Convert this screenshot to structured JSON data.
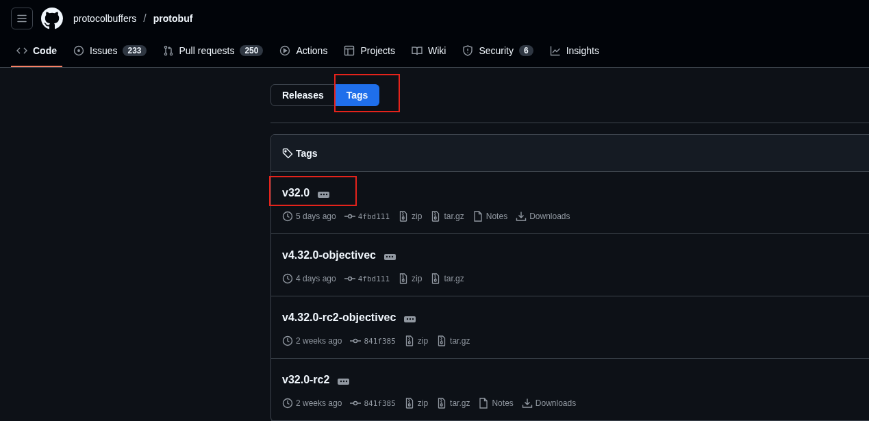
{
  "header": {
    "owner": "protocolbuffers",
    "separator": "/",
    "repo": "protobuf"
  },
  "nav_tabs": [
    {
      "label": "Code",
      "selected": true
    },
    {
      "label": "Issues",
      "count": "233",
      "selected": false
    },
    {
      "label": "Pull requests",
      "count": "250",
      "selected": false
    },
    {
      "label": "Actions",
      "selected": false
    },
    {
      "label": "Projects",
      "selected": false
    },
    {
      "label": "Wiki",
      "selected": false
    },
    {
      "label": "Security",
      "count": "6",
      "selected": false
    },
    {
      "label": "Insights",
      "selected": false
    }
  ],
  "toggle": [
    {
      "label": "Releases",
      "selected": false,
      "highlighted": false
    },
    {
      "label": "Tags",
      "selected": true,
      "highlighted": true
    }
  ],
  "tags_box": {
    "title": "Tags",
    "tags": [
      {
        "name": "v32.0",
        "highlighted": true,
        "date": "5 days ago",
        "commit": "4fbd111",
        "assets": [
          {
            "kind": "archive",
            "label": "zip"
          },
          {
            "kind": "archive",
            "label": "tar.gz"
          },
          {
            "kind": "notes",
            "label": "Notes"
          },
          {
            "kind": "downloads",
            "label": "Downloads"
          }
        ]
      },
      {
        "name": "v4.32.0-objectivec",
        "highlighted": false,
        "date": "4 days ago",
        "commit": "4fbd111",
        "assets": [
          {
            "kind": "archive",
            "label": "zip"
          },
          {
            "kind": "archive",
            "label": "tar.gz"
          }
        ]
      },
      {
        "name": "v4.32.0-rc2-objectivec",
        "highlighted": false,
        "date": "2 weeks ago",
        "commit": "841f385",
        "assets": [
          {
            "kind": "archive",
            "label": "zip"
          },
          {
            "kind": "archive",
            "label": "tar.gz"
          }
        ]
      },
      {
        "name": "v32.0-rc2",
        "highlighted": false,
        "date": "2 weeks ago",
        "commit": "841f385",
        "assets": [
          {
            "kind": "archive",
            "label": "zip"
          },
          {
            "kind": "archive",
            "label": "tar.gz"
          },
          {
            "kind": "notes",
            "label": "Notes"
          },
          {
            "kind": "downloads",
            "label": "Downloads"
          }
        ]
      }
    ]
  }
}
